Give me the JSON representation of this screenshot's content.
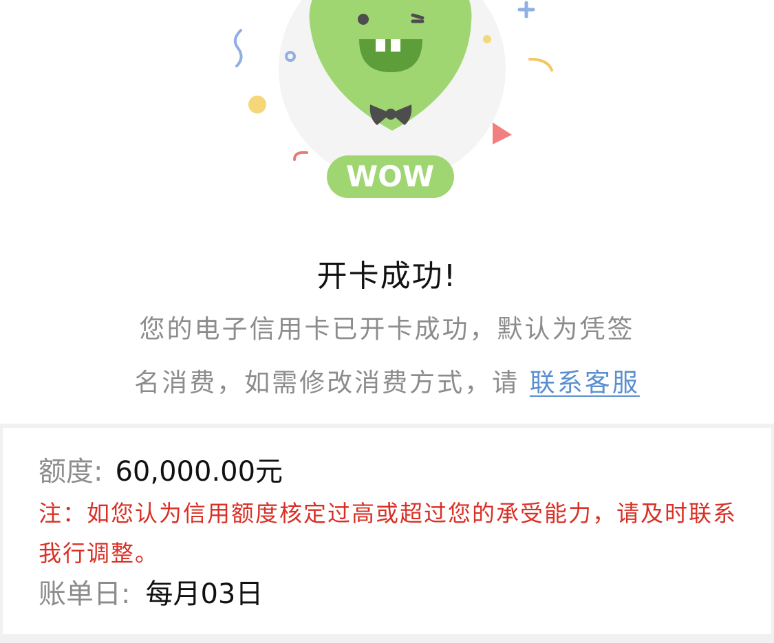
{
  "header": {
    "illustration_icon": "wow-balloon-mascot",
    "badge_text": "WOW"
  },
  "result": {
    "title": "开卡成功!",
    "desc_line1": "您的电子信用卡已开卡成功，默认为凭签",
    "desc_line2": "名消费，如需修改消费方式，请 ",
    "contact_link": "联系客服"
  },
  "card_info": {
    "limit_label": "额度:",
    "limit_value": "60,000.00元",
    "note": "注：如您认为信用额度核定过高或超过您的承受能力，请及时联系我行调整。",
    "bill_label": "账单日:",
    "bill_value": "每月03日"
  },
  "colors": {
    "mascot_green": "#9fd672",
    "note_red": "#d93026",
    "link_blue": "#5b8fcf"
  }
}
